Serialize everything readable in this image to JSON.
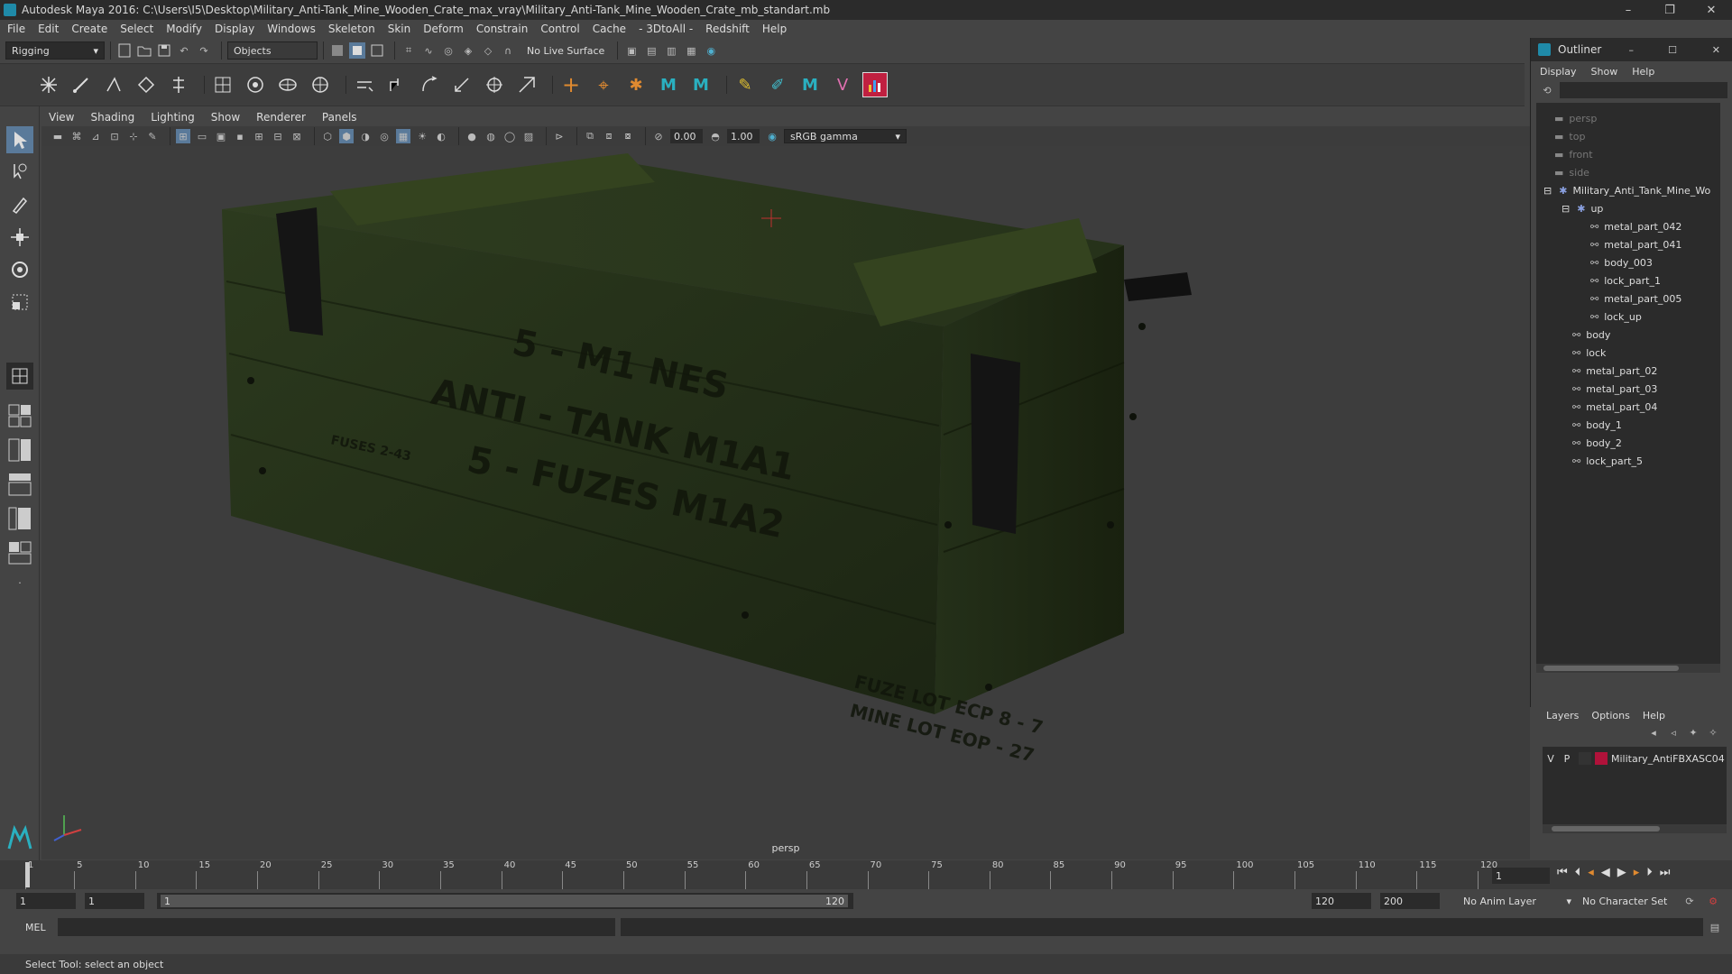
{
  "window": {
    "title": "Autodesk Maya 2016: C:\\Users\\I5\\Desktop\\Military_Anti-Tank_Mine_Wooden_Crate_max_vray\\Military_Anti-Tank_Mine_Wooden_Crate_mb_standart.mb",
    "minimize": "–",
    "restore": "❐",
    "close": "✕"
  },
  "menu": [
    "File",
    "Edit",
    "Create",
    "Select",
    "Modify",
    "Display",
    "Windows",
    "Skeleton",
    "Skin",
    "Deform",
    "Constrain",
    "Control",
    "Cache",
    "- 3DtoAll -",
    "Redshift",
    "Help"
  ],
  "status": {
    "mode": "Rigging",
    "select_mode": "Objects",
    "live_surface": "No Live Surface"
  },
  "panel": {
    "menu": [
      "View",
      "Shading",
      "Lighting",
      "Show",
      "Renderer",
      "Panels"
    ],
    "exposure": "0.00",
    "gamma": "1.00",
    "color_space": "sRGB gamma",
    "camera": "persp"
  },
  "crate": {
    "text_lines": [
      "5 - M1 NES",
      "ANTI - TANK M1A1",
      "5 - FUZES M1A2"
    ],
    "side_stamp": "FUSES 2-43",
    "bottom_lines": [
      "FUZE LOT ECP 8 - 7",
      "MINE LOT EOP - 27"
    ],
    "wood_color": "#25301a",
    "wood_dark": "#1a2212"
  },
  "outliner": {
    "title": "Outliner",
    "menu": [
      "Display",
      "Show",
      "Help"
    ],
    "items": [
      {
        "label": "persp",
        "indent": 0
      },
      {
        "label": "top",
        "indent": 0
      },
      {
        "label": "front",
        "indent": 0
      },
      {
        "label": "side",
        "indent": 0
      },
      {
        "label": "Military_Anti_Tank_Mine_Wo",
        "indent": 0
      },
      {
        "label": "up",
        "indent": 1
      },
      {
        "label": "metal_part_042",
        "indent": 2
      },
      {
        "label": "metal_part_041",
        "indent": 2
      },
      {
        "label": "body_003",
        "indent": 2
      },
      {
        "label": "lock_part_1",
        "indent": 2
      },
      {
        "label": "metal_part_005",
        "indent": 2
      },
      {
        "label": "lock_up",
        "indent": 2
      },
      {
        "label": "body",
        "indent": 1
      },
      {
        "label": "lock",
        "indent": 1
      },
      {
        "label": "metal_part_02",
        "indent": 1
      },
      {
        "label": "metal_part_03",
        "indent": 1
      },
      {
        "label": "metal_part_04",
        "indent": 1
      },
      {
        "label": "body_1",
        "indent": 1
      },
      {
        "label": "body_2",
        "indent": 1
      },
      {
        "label": "lock_part_5",
        "indent": 1
      }
    ]
  },
  "layers": {
    "menu": [
      "Layers",
      "Options",
      "Help"
    ],
    "row": {
      "v": "V",
      "p": "P",
      "name": "Military_AntiFBXASC04",
      "color": "#b0123a"
    }
  },
  "timeline": {
    "ticks": [
      "1",
      "5",
      "10",
      "15",
      "20",
      "25",
      "30",
      "35",
      "40",
      "45",
      "50",
      "55",
      "60",
      "65",
      "70",
      "75",
      "80",
      "85",
      "90",
      "95",
      "100",
      "105",
      "110",
      "115",
      "120"
    ],
    "current_frame": "1"
  },
  "range": {
    "start": "1",
    "playback_start": "1",
    "slider_start": "1",
    "slider_end": "120",
    "playback_end": "120",
    "end": "200",
    "anim_layer": "No Anim Layer",
    "character_set": "No Character Set"
  },
  "cmd": {
    "label": "MEL"
  },
  "help": {
    "text": "Select Tool: select an object"
  }
}
